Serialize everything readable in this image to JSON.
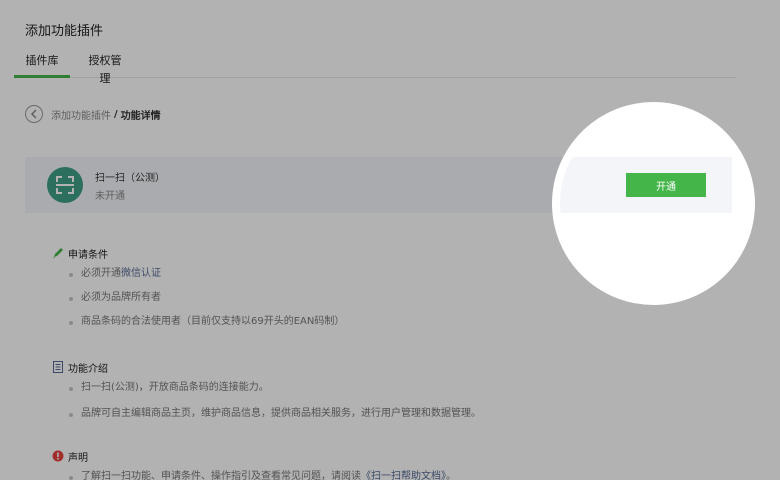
{
  "page_title": "添加功能插件",
  "tabs": [
    {
      "label": "插件库",
      "active": true
    },
    {
      "label": "授权管理",
      "active": false
    }
  ],
  "breadcrumb": {
    "parent": "添加功能插件",
    "separator": "/",
    "current": "功能详情"
  },
  "plugin": {
    "name": "扫一扫（公测）",
    "status": "未开通",
    "open_label": "开通"
  },
  "conditions": {
    "title": "申请条件",
    "items": [
      {
        "text": "必须开通",
        "link": "微信认证"
      },
      {
        "text": "必须为品牌所有者"
      },
      {
        "text": "商品条码的合法使用者（目前仅支持以69开头的EAN码制）"
      }
    ]
  },
  "intro": {
    "title": "功能介绍",
    "items": [
      "扫一扫(公测)，开放商品条码的连接能力。",
      "品牌可自主编辑商品主页，维护商品信息，提供商品相关服务，进行用户管理和数据管理。"
    ]
  },
  "statement": {
    "title": "声明",
    "text": "了解扫一扫功能、申请条件、操作指引及查看常见问题，请阅读",
    "link": "《扫一扫帮助文档》",
    "tail": "。"
  },
  "colors": {
    "accent_green": "#44b549",
    "link_blue": "#576b95",
    "logo_teal": "#3fa089",
    "warning_red": "#e64340"
  }
}
